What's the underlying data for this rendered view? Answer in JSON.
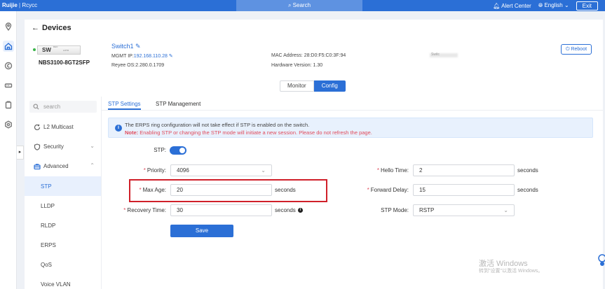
{
  "topbar": {
    "brand": "Ruijie",
    "separator": "|",
    "brand_sub": "Rcycc",
    "search_label": "Search",
    "alert_center": "Alert Center",
    "language": "English",
    "exit": "Exit",
    "color": "#2b6fd6"
  },
  "leftnav": {
    "icons": [
      "map-pin-icon",
      "home-icon",
      "coin-icon",
      "device-icon",
      "clipboard-icon",
      "settings-icon"
    ],
    "active": "home-icon",
    "collapse_glyph": "▸"
  },
  "page": {
    "title": "Devices",
    "back_glyph": "←"
  },
  "device": {
    "badge": "SW",
    "tiny_label": "DHC",
    "tiny_model": "LOTR",
    "model": "NBS3100-8GT2SFP",
    "name": "Switch1",
    "edit_glyph": "✎",
    "mgmt_ip_label": "MGMT IP:",
    "mgmt_ip": "192.168.110.28",
    "os_label": "Reyee OS:",
    "os": "2.280.0.1709",
    "mac_label": "MAC Address:",
    "mac": "28:D0:F5:C0:3F:94",
    "hw_label": "Hardware Version:",
    "hw": "1.30",
    "blurred_text": "Switc",
    "status_color": "#3bb54a",
    "reboot_label": "Reboot"
  },
  "view_toggle": {
    "monitor": "Monitor",
    "config": "Config",
    "selected": "Config"
  },
  "sidemenu": {
    "search_placeholder": "search",
    "items": [
      {
        "label": "L2 Multicast",
        "icon": "refresh-icon"
      },
      {
        "label": "Security",
        "icon": "shield-icon",
        "chevron": "⌄"
      },
      {
        "label": "Advanced",
        "icon": "toolbox-icon",
        "chevron": "⌃"
      },
      {
        "label": "STP",
        "selected": true
      },
      {
        "label": "LLDP"
      },
      {
        "label": "RLDP"
      },
      {
        "label": "ERPS"
      },
      {
        "label": "QoS"
      },
      {
        "label": "Voice VLAN"
      }
    ]
  },
  "tabs": {
    "stp_settings": "STP Settings",
    "stp_management": "STP Management",
    "active": "STP Settings"
  },
  "alert": {
    "icon": "i",
    "line1": "The ERPS ring configuration will not take effect if STP is enabled on the switch.",
    "note_label": "Note:",
    "line2": " Enabling STP or changing the STP mode will initiate a new session. Please do not refresh the page."
  },
  "form": {
    "stp_label": "STP:",
    "stp_enabled": true,
    "priority_label": "Priority:",
    "priority_value": "4096",
    "max_age_label": "Max Age:",
    "max_age_value": "20",
    "max_age_unit": "seconds",
    "recovery_label": "Recovery Time:",
    "recovery_value": "30",
    "recovery_unit": "seconds",
    "recovery_hint": "i",
    "hello_label": "Hello Time:",
    "hello_value": "2",
    "hello_unit": "seconds",
    "fwd_label": "Forward Delay:",
    "fwd_value": "15",
    "fwd_unit": "seconds",
    "mode_label": "STP Mode:",
    "mode_value": "RSTP",
    "required_mark": "*",
    "select_chevron": "⌄",
    "save_label": "Save",
    "highlight_color": "#d0202a"
  },
  "watermark": {
    "line1": "激活 Windows",
    "line2": "转到\"设置\"以激活 Windows。"
  }
}
